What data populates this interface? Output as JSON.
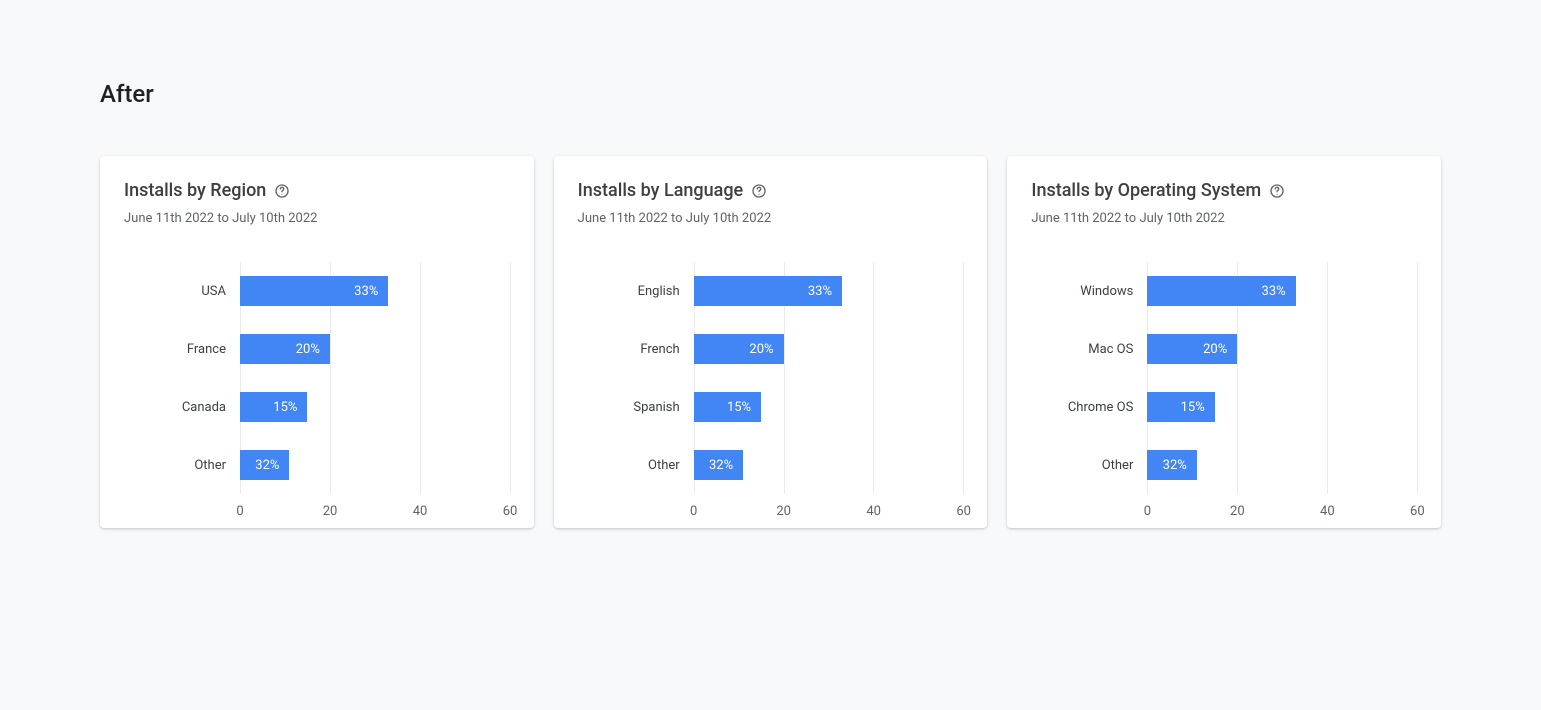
{
  "page_title": "After",
  "date_range": "June 11th 2022 to July 10th 2022",
  "axis": {
    "max": 60,
    "ticks": [
      0,
      20,
      40,
      60
    ]
  },
  "cards": [
    {
      "title": "Installs by Region",
      "bars": [
        {
          "label": "USA",
          "value": 33,
          "display": "33%"
        },
        {
          "label": "France",
          "value": 20,
          "display": "20%"
        },
        {
          "label": "Canada",
          "value": 15,
          "display": "15%"
        },
        {
          "label": "Other",
          "value": 32,
          "display": "32%",
          "width_override": 11
        }
      ]
    },
    {
      "title": "Installs by Language",
      "bars": [
        {
          "label": "English",
          "value": 33,
          "display": "33%"
        },
        {
          "label": "French",
          "value": 20,
          "display": "20%"
        },
        {
          "label": "Spanish",
          "value": 15,
          "display": "15%"
        },
        {
          "label": "Other",
          "value": 32,
          "display": "32%",
          "width_override": 11
        }
      ]
    },
    {
      "title": "Installs by Operating System",
      "bars": [
        {
          "label": "Windows",
          "value": 33,
          "display": "33%"
        },
        {
          "label": "Mac OS",
          "value": 20,
          "display": "20%"
        },
        {
          "label": "Chrome OS",
          "value": 15,
          "display": "15%"
        },
        {
          "label": "Other",
          "value": 32,
          "display": "32%",
          "width_override": 11
        }
      ]
    }
  ],
  "chart_data": [
    {
      "type": "bar",
      "title": "Installs by Region",
      "subtitle": "June 11th 2022 to July 10th 2022",
      "orientation": "horizontal",
      "categories": [
        "USA",
        "France",
        "Canada",
        "Other"
      ],
      "values": [
        33,
        20,
        15,
        32
      ],
      "value_suffix": "%",
      "xlim": [
        0,
        60
      ],
      "xticks": [
        0,
        20,
        40,
        60
      ]
    },
    {
      "type": "bar",
      "title": "Installs by Language",
      "subtitle": "June 11th 2022 to July 10th 2022",
      "orientation": "horizontal",
      "categories": [
        "English",
        "French",
        "Spanish",
        "Other"
      ],
      "values": [
        33,
        20,
        15,
        32
      ],
      "value_suffix": "%",
      "xlim": [
        0,
        60
      ],
      "xticks": [
        0,
        20,
        40,
        60
      ]
    },
    {
      "type": "bar",
      "title": "Installs by Operating System",
      "subtitle": "June 11th 2022 to July 10th 2022",
      "orientation": "horizontal",
      "categories": [
        "Windows",
        "Mac OS",
        "Chrome OS",
        "Other"
      ],
      "values": [
        33,
        20,
        15,
        32
      ],
      "value_suffix": "%",
      "xlim": [
        0,
        60
      ],
      "xticks": [
        0,
        20,
        40,
        60
      ]
    }
  ]
}
